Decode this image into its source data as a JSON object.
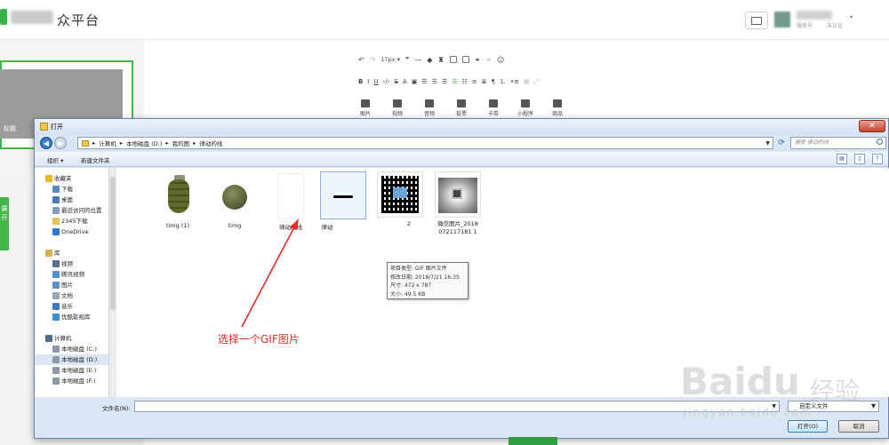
{
  "header": {
    "title": "众平台",
    "account_type": "服务号",
    "account_status": "未认证",
    "caret": "▾"
  },
  "left": {
    "cover_label": "标题",
    "expand_label": "展开"
  },
  "editor": {
    "font_size": "17px ▾",
    "insert_items": [
      "图片",
      "视频",
      "音频",
      "投票",
      "卡券",
      "小程序",
      "商品"
    ]
  },
  "dialog": {
    "title": "打开",
    "close": "✕",
    "breadcrumb": [
      "计算机",
      "本地磁盘 (D:)",
      "我的图",
      "律动的线"
    ],
    "search_placeholder": "搜索 律动的线",
    "commands": {
      "organize": "组织 ▾",
      "new_folder": "新建文件夹"
    },
    "nav": [
      {
        "label": "收藏夹",
        "group": true,
        "icon": "star-icon",
        "color": "#e8b92c"
      },
      {
        "label": "下载",
        "icon": "download-folder-icon",
        "color": "#5b86c4"
      },
      {
        "label": "桌面",
        "icon": "desktop-icon",
        "color": "#4a79b9"
      },
      {
        "label": "最近访问的位置",
        "icon": "recent-places-icon",
        "color": "#7f9cc2"
      },
      {
        "label": "2345下载",
        "icon": "folder-icon",
        "color": "#e8c35a"
      },
      {
        "label": "OneDrive",
        "icon": "onedrive-icon",
        "color": "#2f78d1"
      },
      {
        "label": "库",
        "group": true,
        "icon": "library-icon",
        "color": "#d8b14a"
      },
      {
        "label": "视频",
        "icon": "video-library-icon",
        "color": "#5b6e8e"
      },
      {
        "label": "腾讯视频",
        "icon": "tencent-video-icon",
        "color": "#4b91d6"
      },
      {
        "label": "图片",
        "icon": "pictures-library-icon",
        "color": "#5c8fc4"
      },
      {
        "label": "文档",
        "icon": "documents-library-icon",
        "color": "#9aa8bb"
      },
      {
        "label": "音乐",
        "icon": "music-library-icon",
        "color": "#3f78b8"
      },
      {
        "label": "优酷影视库",
        "icon": "youku-library-icon",
        "color": "#3b8bd8"
      },
      {
        "label": "计算机",
        "group": true,
        "icon": "computer-icon",
        "color": "#4f6d90"
      },
      {
        "label": "本地磁盘 (C:)",
        "icon": "drive-icon",
        "color": "#8c98a8"
      },
      {
        "label": "本地磁盘 (D:)",
        "icon": "drive-icon",
        "color": "#8c98a8",
        "selected": true
      },
      {
        "label": "本地磁盘 (E:)",
        "icon": "drive-icon",
        "color": "#8c98a8"
      },
      {
        "label": "本地磁盘 (F:)",
        "icon": "drive-icon",
        "color": "#8c98a8"
      }
    ],
    "files": [
      {
        "name": "timg (1)",
        "kind": "grenade"
      },
      {
        "name": "timg",
        "kind": "ball"
      },
      {
        "name": "律动的线",
        "kind": "blank"
      },
      {
        "name": "律动",
        "kind": "line"
      },
      {
        "name": "2",
        "kind": "qr"
      },
      {
        "name": "微信图片_2018072117181 1",
        "kind": "tunnel"
      }
    ],
    "tooltip": {
      "type": "项目类型: GIF 图片文件",
      "modified": "修改日期: 2018/7/21 16:35",
      "size": "尺寸: 472 x 787",
      "filesize": "大小: 49.5 KB"
    },
    "filename_label": "文件名(N):",
    "filetype": "自定义文件",
    "open_button": "打开(O)",
    "cancel_button": "取消"
  },
  "annotation": {
    "text": "选择一个GIF图片",
    "color": "#e52b2b"
  },
  "watermark": {
    "brand": "Baidu",
    "cn": "经验",
    "url": "jingyan.baidu.com"
  }
}
